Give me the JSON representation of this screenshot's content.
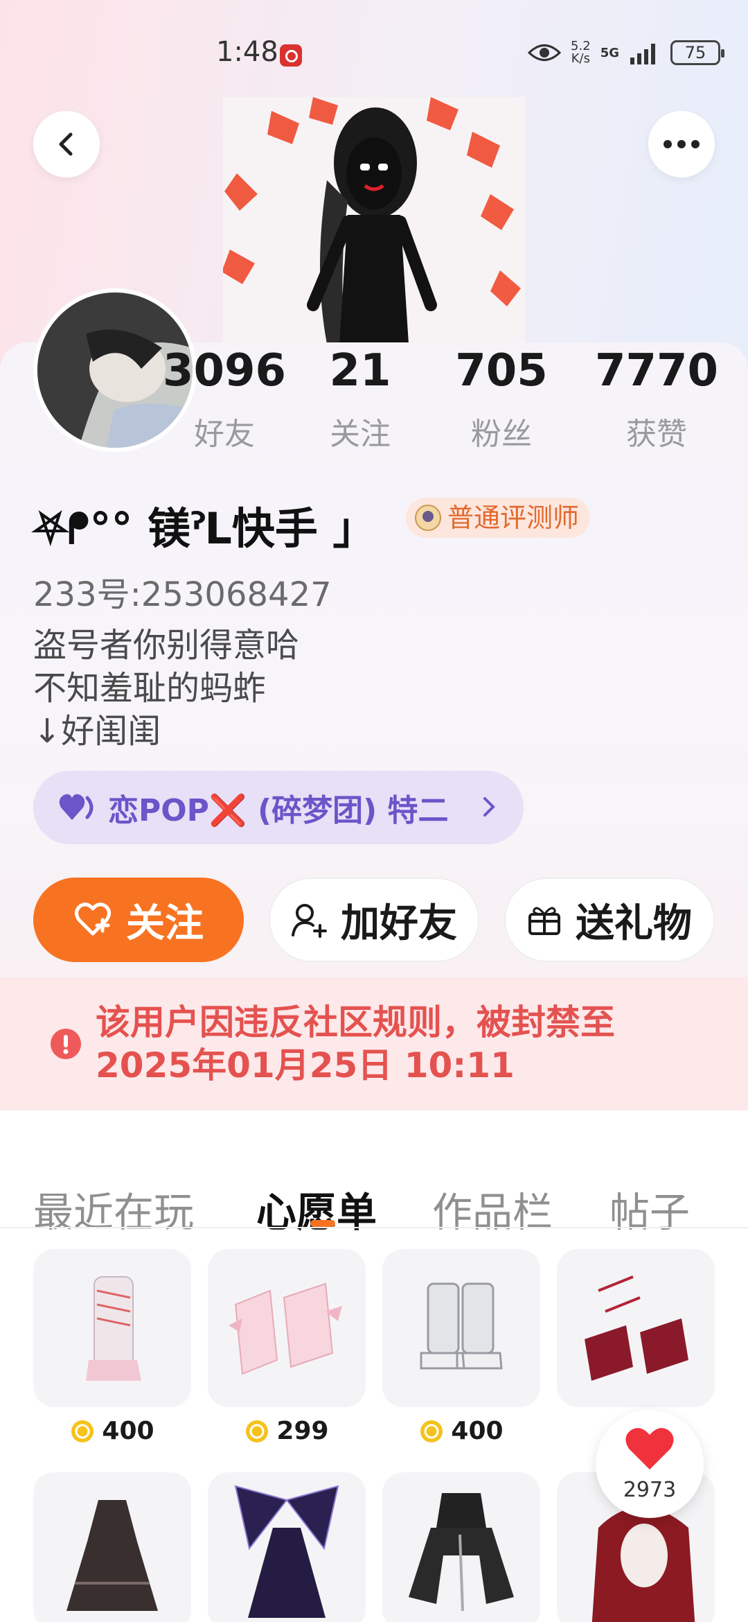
{
  "status_bar": {
    "time": "1:48",
    "net_speed_value": "5.2",
    "net_speed_unit": "K/s",
    "network": "5G",
    "battery": "75"
  },
  "header": {
    "back_icon": "chevron-left-icon",
    "more_icon": "more-dots-icon"
  },
  "stats": [
    {
      "value": "3096",
      "label": "好友"
    },
    {
      "value": "21",
      "label": "关注"
    },
    {
      "value": "705",
      "label": "粉丝"
    },
    {
      "value": "7770",
      "label": "获赞"
    }
  ],
  "profile": {
    "nickname": "⛧ᖰ°° 镁ˀL快手 」",
    "badge": "普通评测师",
    "uid": "233号:253068427",
    "bio": [
      "盗号者你别得意哈",
      "不知羞耻的蚂蚱",
      "↓好闺闺"
    ],
    "group": "恋POP❌ (碎梦团) 特二"
  },
  "actions": {
    "follow": "关注",
    "add_friend": "加好友",
    "gift": "送礼物"
  },
  "ban_notice": [
    "该用户因违反社区规则，被封禁至",
    "2025年01月25日 10:11"
  ],
  "tabs": [
    "最近在玩",
    "心愿单",
    "作品栏",
    "帖子"
  ],
  "active_tab": "心愿单",
  "wishlist": [
    {
      "name": "pink-leg-warmer-boots",
      "price": "400"
    },
    {
      "name": "pink-bow-boots",
      "price": "299"
    },
    {
      "name": "grey-buckle-boots",
      "price": "400"
    },
    {
      "name": "red-ribbon-heels",
      "price": ""
    },
    {
      "name": "black-gothic-dress",
      "price": ""
    },
    {
      "name": "butterfly-wing-dress",
      "price": ""
    },
    {
      "name": "black-hooded-jacket",
      "price": ""
    },
    {
      "name": "red-long-hair",
      "price": ""
    }
  ],
  "likes": "2973",
  "colors": {
    "accent": "#f77322",
    "ban_text": "#e4524f",
    "group_text": "#6b55c9"
  }
}
